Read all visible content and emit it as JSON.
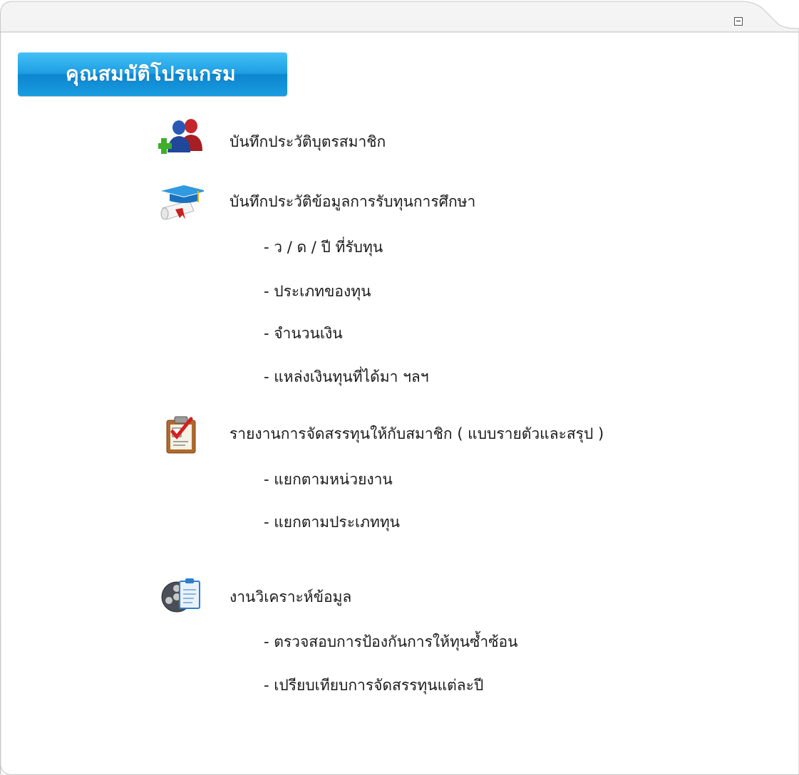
{
  "panel": {
    "title": "คุณสมบัติโปรแกรม",
    "collapse_icon": "minus-box-icon",
    "accent": "#1e9ee3"
  },
  "features": [
    {
      "icon": "users-add-icon",
      "title": "บันทึกประวัติบุตรสมาชิก",
      "items": []
    },
    {
      "icon": "graduation-scholarship-icon",
      "title": "บันทึกประวัติข้อมูลการรับทุนการศึกษา",
      "items": [
        "- ว / ด / ปี  ที่รับทุน",
        "- ประเภทของทุน",
        "- จำนวนเงิน",
        "- แหล่งเงินทุนที่ได้มา ฯลฯ"
      ]
    },
    {
      "icon": "clipboard-check-icon",
      "title": "รายงานการจัดสรรทุนให้กับสมาชิก ( แบบรายตัวและสรุป )",
      "items": [
        "- แยกตามหน่วยงาน",
        "- แยกตามประเภททุน"
      ]
    },
    {
      "icon": "film-reel-document-icon",
      "title": "งานวิเคราะห์ข้อมูล",
      "items": [
        "- ตรวจสอบการป้องกันการให้ทุนซ้ำซ้อน",
        "- เปรียบเทียบการจัดสรรทุนแต่ละปี"
      ]
    }
  ]
}
